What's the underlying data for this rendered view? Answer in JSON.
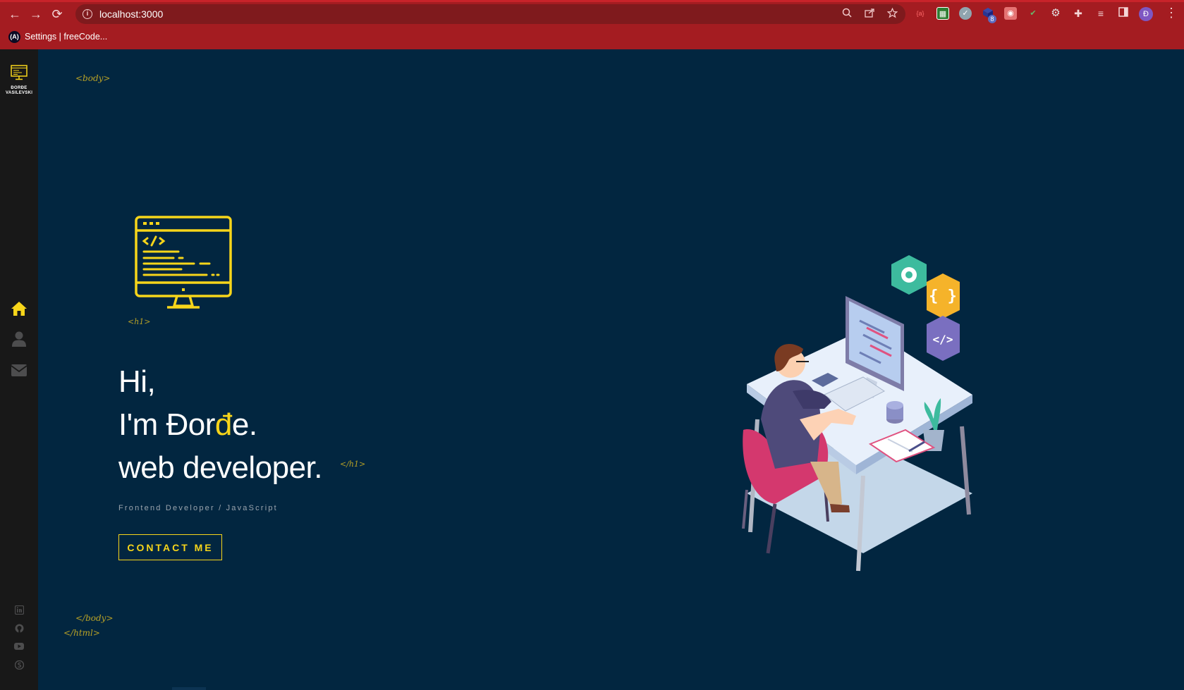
{
  "browser": {
    "url": "localhost:3000",
    "bookmark_label": "Settings | freeCode...",
    "bookmark_favicon": "(A)",
    "profile_initial": "Đ",
    "extension_badge": "8",
    "extensions": [
      "zoom-icon",
      "share-icon",
      "star-icon",
      "ext-bracket-icon",
      "ext-table-icon",
      "ext-check-icon",
      "ext-cube-icon",
      "ext-screenshot-icon",
      "ext-checkmark-icon",
      "ext-gear-icon",
      "puzzle-icon",
      "media-icon",
      "sidepanel-icon"
    ]
  },
  "sidebar": {
    "logo_name_line1": "ĐORĐE",
    "logo_name_line2": "VASILEVSKI",
    "nav": [
      "home-icon",
      "user-icon",
      "envelope-icon"
    ],
    "social": [
      "linkedin-icon",
      "github-icon",
      "youtube-icon",
      "skype-icon"
    ],
    "active_color": "#f7d51a"
  },
  "main": {
    "tag_body_open": "<body>",
    "tag_h1_open": "<h1>",
    "tag_h1_close": "</h1>",
    "tag_body_close": "</body>",
    "tag_html_close": "</html>",
    "hero_line1": "Hi,",
    "hero_line2_prefix": "I'm Đor",
    "hero_line2_accent": "đ",
    "hero_line2_suffix": "e.",
    "hero_line3": "web developer.",
    "subtitle": "Frontend Developer / JavaScript",
    "contact_button": "CONTACT ME",
    "accent_color": "#f7d51a",
    "background_color": "#022640"
  }
}
